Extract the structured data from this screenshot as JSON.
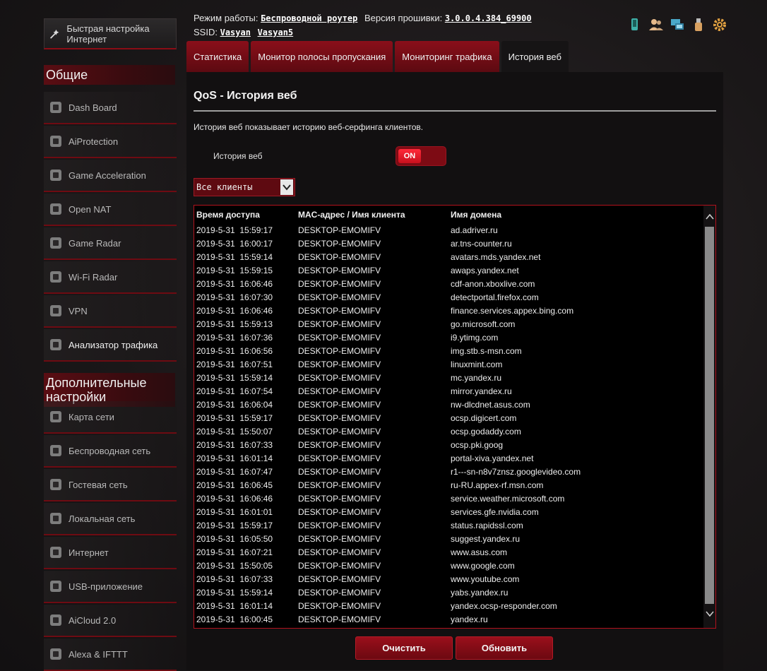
{
  "header": {
    "mode_label": "Режим работы:",
    "mode_value": "Беспроводной роутер",
    "firmware_label": "Версия прошивки:",
    "firmware_value": "3.0.0.4.384_69900",
    "ssid_label": "SSID:",
    "ssid_1": "Vasyan",
    "ssid_2": "Vasyan5",
    "icons": [
      "usb-device-icon",
      "clients-icon",
      "network-map-icon",
      "usb-icon",
      "settings-gear-icon"
    ]
  },
  "sidebar": {
    "quick_setup": "Быстрая настройка Интернет",
    "general_heading": "Общие",
    "general_items": [
      {
        "label": "Dash Board",
        "icon": "dashboard-icon"
      },
      {
        "label": "AiProtection",
        "icon": "lock-icon"
      },
      {
        "label": "Game Acceleration",
        "icon": "rocket-icon"
      },
      {
        "label": "Open NAT",
        "icon": "nat-icon"
      },
      {
        "label": "Game Radar",
        "icon": "radar-icon"
      },
      {
        "label": "Wi-Fi Radar",
        "icon": "wifi-radar-icon"
      },
      {
        "label": "VPN",
        "icon": "vpn-icon"
      },
      {
        "label": "Анализатор трафика",
        "icon": "traffic-analyzer-icon"
      }
    ],
    "advanced_heading": "Дополнительные настройки",
    "advanced_items": [
      {
        "label": "Карта сети",
        "icon": "network-map-icon"
      },
      {
        "label": "Беспроводная сеть",
        "icon": "wireless-icon"
      },
      {
        "label": "Гостевая сеть",
        "icon": "guest-network-icon"
      },
      {
        "label": "Локальная сеть",
        "icon": "lan-icon"
      },
      {
        "label": "Интернет",
        "icon": "globe-icon"
      },
      {
        "label": "USB-приложение",
        "icon": "usb-app-icon"
      },
      {
        "label": "AiCloud 2.0",
        "icon": "cloud-icon"
      },
      {
        "label": "Alexa & IFTTT",
        "icon": "alexa-icon"
      }
    ]
  },
  "tabs": [
    "Статистика",
    "Монитор полосы пропускания",
    "Мониторинг трафика",
    "История веб"
  ],
  "main": {
    "title": "QoS - История веб",
    "description": "История веб показывает историю веб-серфинга клиентов.",
    "toggle_label": "История веб",
    "toggle_state": "ON",
    "client_select": "Все клиенты",
    "columns": [
      "Время доступа",
      "MAC-адрес / Имя клиента",
      "Имя домена"
    ],
    "rows": [
      [
        "2019-5-31  15:59:17",
        "DESKTOP-EMOMIFV",
        "ad.adriver.ru"
      ],
      [
        "2019-5-31  16:00:17",
        "DESKTOP-EMOMIFV",
        "ar.tns-counter.ru"
      ],
      [
        "2019-5-31  15:59:14",
        "DESKTOP-EMOMIFV",
        "avatars.mds.yandex.net"
      ],
      [
        "2019-5-31  15:59:15",
        "DESKTOP-EMOMIFV",
        "awaps.yandex.net"
      ],
      [
        "2019-5-31  16:06:46",
        "DESKTOP-EMOMIFV",
        "cdf-anon.xboxlive.com"
      ],
      [
        "2019-5-31  16:07:30",
        "DESKTOP-EMOMIFV",
        "detectportal.firefox.com"
      ],
      [
        "2019-5-31  16:06:46",
        "DESKTOP-EMOMIFV",
        "finance.services.appex.bing.com"
      ],
      [
        "2019-5-31  15:59:13",
        "DESKTOP-EMOMIFV",
        "go.microsoft.com"
      ],
      [
        "2019-5-31  16:07:36",
        "DESKTOP-EMOMIFV",
        "i9.ytimg.com"
      ],
      [
        "2019-5-31  16:06:56",
        "DESKTOP-EMOMIFV",
        "img.stb.s-msn.com"
      ],
      [
        "2019-5-31  16:07:51",
        "DESKTOP-EMOMIFV",
        "linuxmint.com"
      ],
      [
        "2019-5-31  15:59:14",
        "DESKTOP-EMOMIFV",
        "mc.yandex.ru"
      ],
      [
        "2019-5-31  16:07:54",
        "DESKTOP-EMOMIFV",
        "mirror.yandex.ru"
      ],
      [
        "2019-5-31  16:06:04",
        "DESKTOP-EMOMIFV",
        "nw-dlcdnet.asus.com"
      ],
      [
        "2019-5-31  15:59:17",
        "DESKTOP-EMOMIFV",
        "ocsp.digicert.com"
      ],
      [
        "2019-5-31  15:50:07",
        "DESKTOP-EMOMIFV",
        "ocsp.godaddy.com"
      ],
      [
        "2019-5-31  16:07:33",
        "DESKTOP-EMOMIFV",
        "ocsp.pki.goog"
      ],
      [
        "2019-5-31  16:01:14",
        "DESKTOP-EMOMIFV",
        "portal-xiva.yandex.net"
      ],
      [
        "2019-5-31  16:07:47",
        "DESKTOP-EMOMIFV",
        "r1---sn-n8v7znsz.googlevideo.com"
      ],
      [
        "2019-5-31  16:06:45",
        "DESKTOP-EMOMIFV",
        "ru-RU.appex-rf.msn.com"
      ],
      [
        "2019-5-31  16:06:46",
        "DESKTOP-EMOMIFV",
        "service.weather.microsoft.com"
      ],
      [
        "2019-5-31  16:01:01",
        "DESKTOP-EMOMIFV",
        "services.gfe.nvidia.com"
      ],
      [
        "2019-5-31  15:59:17",
        "DESKTOP-EMOMIFV",
        "status.rapidssl.com"
      ],
      [
        "2019-5-31  16:05:50",
        "DESKTOP-EMOMIFV",
        "suggest.yandex.ru"
      ],
      [
        "2019-5-31  16:07:21",
        "DESKTOP-EMOMIFV",
        "www.asus.com"
      ],
      [
        "2019-5-31  15:50:05",
        "DESKTOP-EMOMIFV",
        "www.google.com"
      ],
      [
        "2019-5-31  16:07:33",
        "DESKTOP-EMOMIFV",
        "www.youtube.com"
      ],
      [
        "2019-5-31  15:59:14",
        "DESKTOP-EMOMIFV",
        "yabs.yandex.ru"
      ],
      [
        "2019-5-31  16:01:14",
        "DESKTOP-EMOMIFV",
        "yandex.ocsp-responder.com"
      ],
      [
        "2019-5-31  16:00:45",
        "DESKTOP-EMOMIFV",
        "yandex.ru"
      ]
    ],
    "clear_button": "Очистить",
    "refresh_button": "Обновить"
  },
  "colors": {
    "accent": "#9a0f1b",
    "background": "#1a1718",
    "table_border": "#b1121d"
  }
}
